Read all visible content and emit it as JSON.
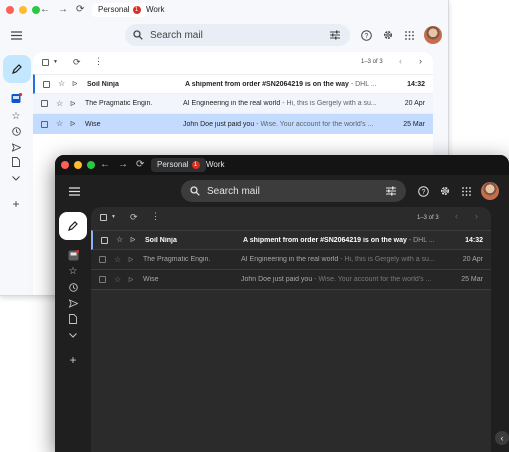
{
  "light": {
    "tabs": [
      {
        "label": "Personal",
        "badge": "1"
      },
      {
        "label": "Work"
      }
    ],
    "search_placeholder": "Search mail",
    "pagination": "1–3 of 3",
    "emails": [
      {
        "sender": "Soil Ninja",
        "subject": "A shipment from order #SN2064219 is on the way",
        "snippet": " - DHL ...",
        "date": "14:32",
        "unread": true
      },
      {
        "sender": "The Pragmatic Engin.",
        "subject": "AI Engineering in the real world",
        "snippet": " - Hi, this is Gergely with a su...",
        "date": "20 Apr",
        "unread": false
      },
      {
        "sender": "Wise",
        "subject": "John Doe just paid you",
        "snippet": " - Wise. Your account for the world's ...",
        "date": "25 Mar",
        "unread": false
      }
    ]
  },
  "dark": {
    "tabs": [
      {
        "label": "Personal",
        "badge": "1"
      },
      {
        "label": "Work"
      }
    ],
    "search_placeholder": "Search mail",
    "pagination": "1–3 of 3",
    "emails": [
      {
        "sender": "Soil Ninja",
        "subject": "A shipment from order #SN2064219 is on the way",
        "snippet": " - DHL ...",
        "date": "14:32",
        "unread": true
      },
      {
        "sender": "The Pragmatic Engin.",
        "subject": "AI Engineering in the real world",
        "snippet": " - Hi, this is Gergely with a su...",
        "date": "20 Apr",
        "unread": false
      },
      {
        "sender": "Wise",
        "subject": "John Doe just paid you",
        "snippet": " - Wise. Your account for the world's ...",
        "date": "25 Mar",
        "unread": false
      }
    ]
  },
  "icons": {
    "back": "arrow-left-icon",
    "forward": "arrow-right-icon",
    "reload": "reload-icon",
    "menu": "hamburger-menu-icon",
    "search": "search-icon",
    "filter": "tune-icon",
    "help": "help-icon",
    "settings": "gear-icon",
    "apps": "apps-grid-icon",
    "compose": "pencil-icon",
    "inbox": "inbox-icon",
    "starred": "star-icon",
    "snoozed": "clock-icon",
    "sent": "send-icon",
    "drafts": "draft-icon",
    "more": "chevron-down-icon",
    "add_label": "plus-icon"
  },
  "colors": {
    "unread_badge": "#d93025",
    "light_selected_row": "#c2dbff",
    "light_unread_bar": "#1a73e8",
    "dark_compose": "#ffffff",
    "dark_unread_bar": "#8ab4f8"
  }
}
